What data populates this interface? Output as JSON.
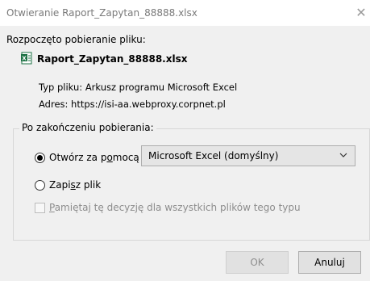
{
  "window": {
    "title": "Otwieranie Raport_Zapytan_88888.xlsx"
  },
  "download": {
    "heading": "Rozpoczęto pobieranie pliku:",
    "filename": "Raport_Zapytan_88888.xlsx",
    "type_label": "Typ pliku:",
    "type_value": "Arkusz programu Microsoft Excel",
    "address_label": "Adres:",
    "address_value": "https://isi-aa.webproxy.corpnet.pl"
  },
  "after_download": {
    "group_label": "Po zakończeniu pobierania:",
    "open_with_label_pre": "Otwórz za p",
    "open_with_label_ul": "o",
    "open_with_label_post": "mocą",
    "app_selected": "Microsoft Excel (domyślny)",
    "save_label_pre": "Zapi",
    "save_label_ul": "s",
    "save_label_post": "z plik",
    "remember_label_ul": "P",
    "remember_label_post": "amiętaj tę decyzję dla wszystkich plików tego typu",
    "selected_option": "open"
  },
  "buttons": {
    "ok": "OK",
    "cancel": "Anuluj"
  },
  "colors": {
    "background": "#f0f0f0",
    "excel_green": "#1d7245"
  },
  "icons": {
    "file": "excel-file-icon",
    "close": "close-icon",
    "dropdown": "chevron-down-icon"
  }
}
